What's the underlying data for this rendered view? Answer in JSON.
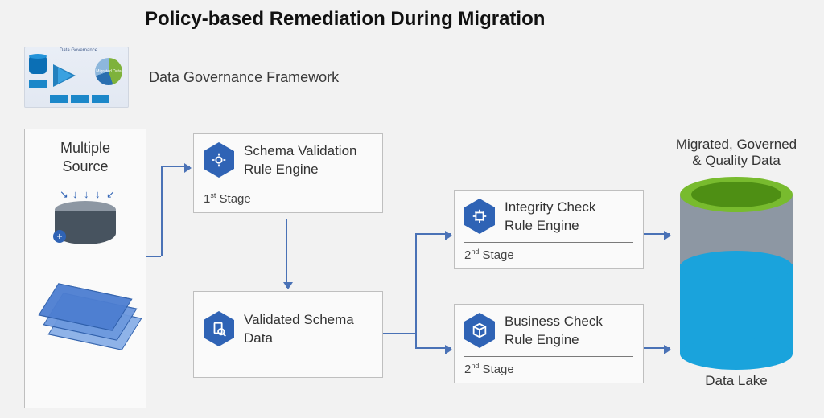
{
  "title": "Policy-based Remediation During Migration",
  "subtitle": "Data Governance Framework",
  "thumbnail": {
    "header": "Data Governance",
    "pie_center": "Migrated Data"
  },
  "source": {
    "title_line1": "Multiple",
    "title_line2": "Source"
  },
  "stages": {
    "schema_validation": {
      "line1": "Schema Validation",
      "line2": "Rule Engine",
      "stage_ordinal": "1",
      "stage_suffix": "st",
      "stage_word": " Stage"
    },
    "validated_schema": {
      "line1": "Validated Schema",
      "line2": "Data"
    },
    "integrity_check": {
      "line1": "Integrity Check",
      "line2": "Rule Engine",
      "stage_ordinal": "2",
      "stage_suffix": "nd",
      "stage_word": "  Stage"
    },
    "business_check": {
      "line1": "Business Check",
      "line2": "Rule Engine",
      "stage_ordinal": "2",
      "stage_suffix": "nd",
      "stage_word": "  Stage"
    }
  },
  "lake": {
    "title_line1": "Migrated, Governed",
    "title_line2": "& Quality Data",
    "caption": "Data Lake"
  }
}
